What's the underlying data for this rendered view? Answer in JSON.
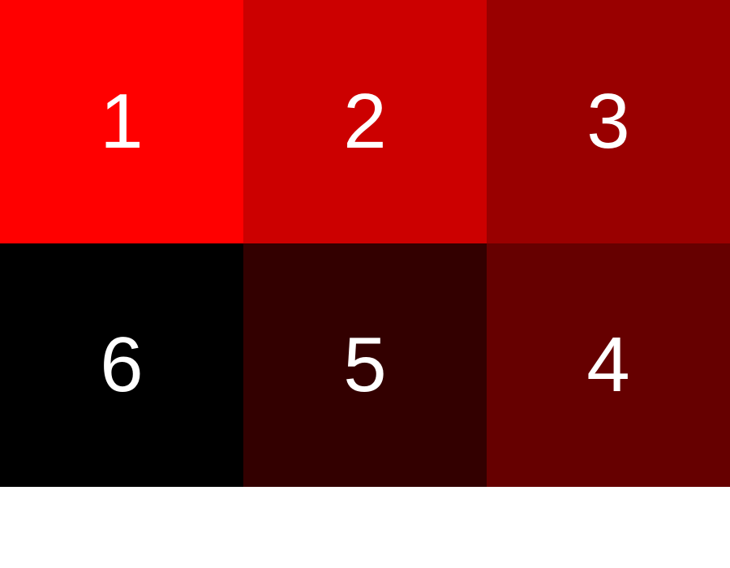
{
  "tiles": [
    {
      "number": "1",
      "color": "#ff0000"
    },
    {
      "number": "2",
      "color": "#cc0000"
    },
    {
      "number": "3",
      "color": "#990000"
    },
    {
      "number": "6",
      "color": "#000000"
    },
    {
      "number": "5",
      "color": "#330000"
    },
    {
      "number": "4",
      "color": "#660000"
    }
  ],
  "number_color": "#ffffff",
  "background_color": "#ffffff"
}
